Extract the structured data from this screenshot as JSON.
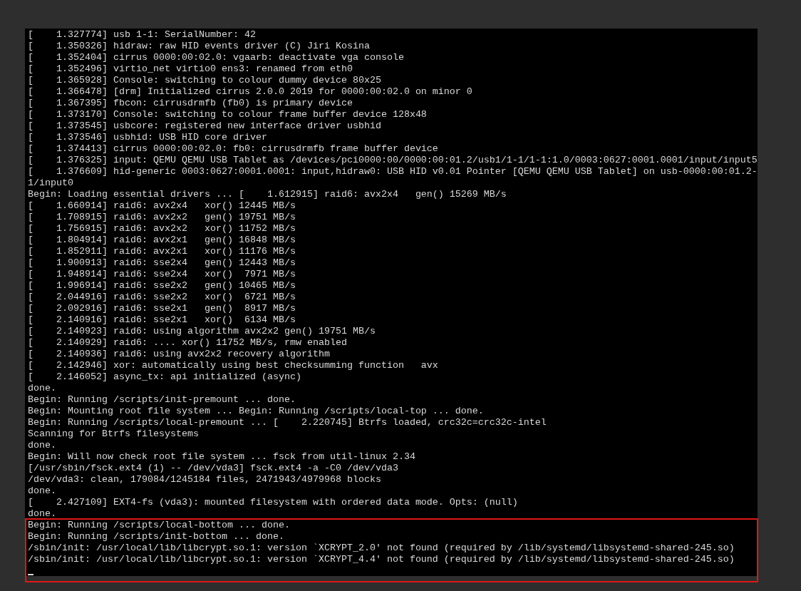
{
  "console": {
    "cursor_visible": true,
    "lines": [
      {
        "text": "[    1.327774] usb 1-1: SerialNumber: 42",
        "highlighted": false
      },
      {
        "text": "[    1.350326] hidraw: raw HID events driver (C) Jiri Kosina",
        "highlighted": false
      },
      {
        "text": "[    1.352404] cirrus 0000:00:02.0: vgaarb: deactivate vga console",
        "highlighted": false
      },
      {
        "text": "[    1.352496] virtio_net virtio0 ens3: renamed from eth0",
        "highlighted": false
      },
      {
        "text": "[    1.365928] Console: switching to colour dummy device 80x25",
        "highlighted": false
      },
      {
        "text": "[    1.366478] [drm] Initialized cirrus 2.0.0 2019 for 0000:00:02.0 on minor 0",
        "highlighted": false
      },
      {
        "text": "[    1.367395] fbcon: cirrusdrmfb (fb0) is primary device",
        "highlighted": false
      },
      {
        "text": "[    1.373170] Console: switching to colour frame buffer device 128x48",
        "highlighted": false
      },
      {
        "text": "[    1.373545] usbcore: registered new interface driver usbhid",
        "highlighted": false
      },
      {
        "text": "[    1.373546] usbhid: USB HID core driver",
        "highlighted": false
      },
      {
        "text": "[    1.374413] cirrus 0000:00:02.0: fb0: cirrusdrmfb frame buffer device",
        "highlighted": false
      },
      {
        "text": "[    1.376325] input: QEMU QEMU USB Tablet as /devices/pci0000:00/0000:00:01.2/usb1/1-1/1-1:1.0/0003:0627:0001.0001/input/input5",
        "highlighted": false
      },
      {
        "text": "[    1.376609] hid-generic 0003:0627:0001.0001: input,hidraw0: USB HID v0.01 Pointer [QEMU QEMU USB Tablet] on usb-0000:00:01.2-",
        "highlighted": false
      },
      {
        "text": "1/input0",
        "highlighted": false
      },
      {
        "text": "Begin: Loading essential drivers ... [    1.612915] raid6: avx2x4   gen() 15269 MB/s",
        "highlighted": false
      },
      {
        "text": "[    1.660914] raid6: avx2x4   xor() 12445 MB/s",
        "highlighted": false
      },
      {
        "text": "[    1.708915] raid6: avx2x2   gen() 19751 MB/s",
        "highlighted": false
      },
      {
        "text": "[    1.756915] raid6: avx2x2   xor() 11752 MB/s",
        "highlighted": false
      },
      {
        "text": "[    1.804914] raid6: avx2x1   gen() 16848 MB/s",
        "highlighted": false
      },
      {
        "text": "[    1.852911] raid6: avx2x1   xor() 11176 MB/s",
        "highlighted": false
      },
      {
        "text": "[    1.900913] raid6: sse2x4   gen() 12443 MB/s",
        "highlighted": false
      },
      {
        "text": "[    1.948914] raid6: sse2x4   xor()  7971 MB/s",
        "highlighted": false
      },
      {
        "text": "[    1.996914] raid6: sse2x2   gen() 10465 MB/s",
        "highlighted": false
      },
      {
        "text": "[    2.044916] raid6: sse2x2   xor()  6721 MB/s",
        "highlighted": false
      },
      {
        "text": "[    2.092916] raid6: sse2x1   gen()  8917 MB/s",
        "highlighted": false
      },
      {
        "text": "[    2.140916] raid6: sse2x1   xor()  6134 MB/s",
        "highlighted": false
      },
      {
        "text": "[    2.140923] raid6: using algorithm avx2x2 gen() 19751 MB/s",
        "highlighted": false
      },
      {
        "text": "[    2.140929] raid6: .... xor() 11752 MB/s, rmw enabled",
        "highlighted": false
      },
      {
        "text": "[    2.140936] raid6: using avx2x2 recovery algorithm",
        "highlighted": false
      },
      {
        "text": "[    2.142946] xor: automatically using best checksumming function   avx",
        "highlighted": false
      },
      {
        "text": "[    2.146052] async_tx: api initialized (async)",
        "highlighted": false
      },
      {
        "text": "done.",
        "highlighted": false
      },
      {
        "text": "Begin: Running /scripts/init-premount ... done.",
        "highlighted": false
      },
      {
        "text": "Begin: Mounting root file system ... Begin: Running /scripts/local-top ... done.",
        "highlighted": false
      },
      {
        "text": "Begin: Running /scripts/local-premount ... [    2.220745] Btrfs loaded, crc32c=crc32c-intel",
        "highlighted": false
      },
      {
        "text": "Scanning for Btrfs filesystems",
        "highlighted": false
      },
      {
        "text": "done.",
        "highlighted": false
      },
      {
        "text": "Begin: Will now check root file system ... fsck from util-linux 2.34",
        "highlighted": false
      },
      {
        "text": "[/usr/sbin/fsck.ext4 (1) -- /dev/vda3] fsck.ext4 -a -C0 /dev/vda3",
        "highlighted": false
      },
      {
        "text": "/dev/vda3: clean, 179084/1245184 files, 2471943/4979968 blocks",
        "highlighted": false
      },
      {
        "text": "done.",
        "highlighted": false
      },
      {
        "text": "[    2.427109] EXT4-fs (vda3): mounted filesystem with ordered data mode. Opts: (null)",
        "highlighted": false
      },
      {
        "text": "done.",
        "highlighted": false
      },
      {
        "text": "Begin: Running /scripts/local-bottom ... done.",
        "highlighted": true
      },
      {
        "text": "Begin: Running /scripts/init-bottom ... done.",
        "highlighted": true
      },
      {
        "text": "/sbin/init: /usr/local/lib/libcrypt.so.1: version `XCRYPT_2.0' not found (required by /lib/systemd/libsystemd-shared-245.so)",
        "highlighted": true
      },
      {
        "text": "/sbin/init: /usr/local/lib/libcrypt.so.1: version `XCRYPT_4.4' not found (required by /lib/systemd/libsystemd-shared-245.so)",
        "highlighted": true
      }
    ]
  }
}
